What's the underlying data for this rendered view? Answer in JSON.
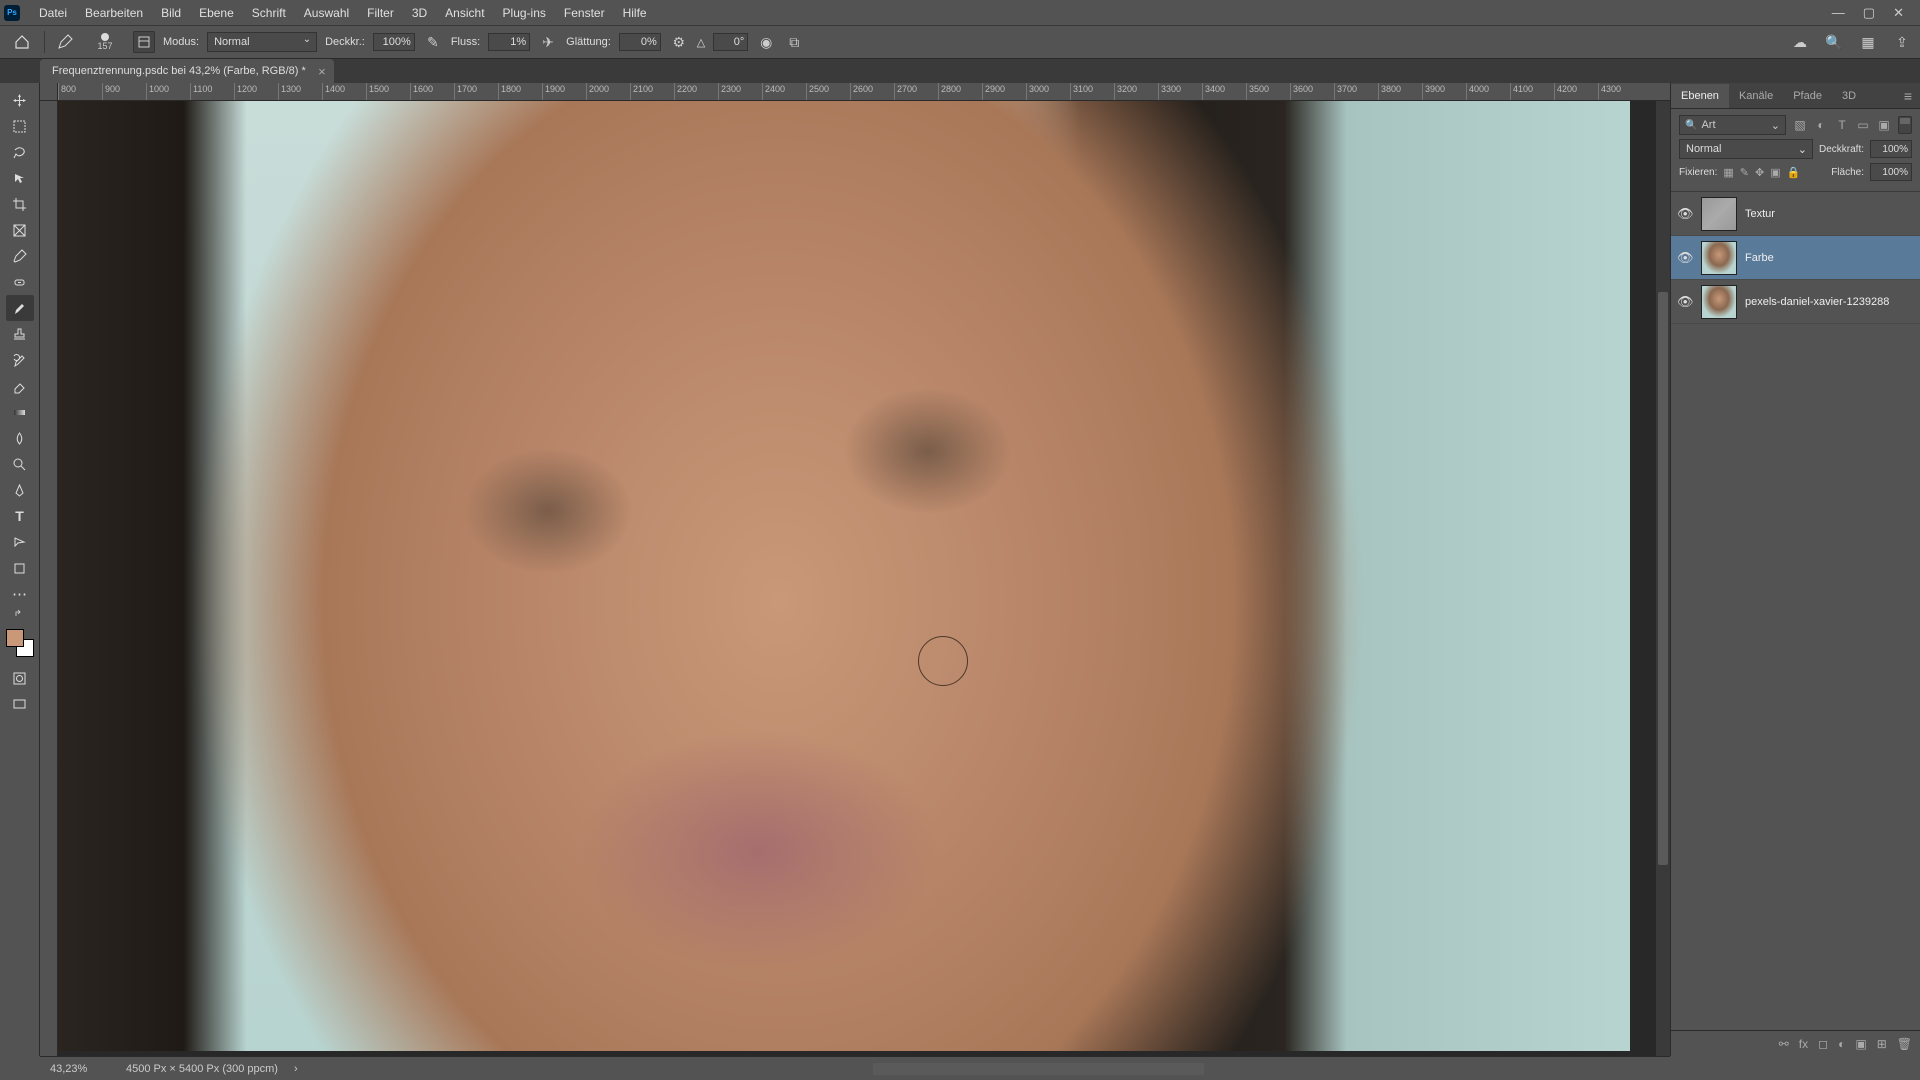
{
  "menu": {
    "items": [
      "Datei",
      "Bearbeiten",
      "Bild",
      "Ebene",
      "Schrift",
      "Auswahl",
      "Filter",
      "3D",
      "Ansicht",
      "Plug-ins",
      "Fenster",
      "Hilfe"
    ]
  },
  "options": {
    "brush_size": "157",
    "mode_label": "Modus:",
    "mode_value": "Normal",
    "opacity_label": "Deckkr.:",
    "opacity_value": "100%",
    "flow_label": "Fluss:",
    "flow_value": "1%",
    "smoothing_label": "Glättung:",
    "smoothing_value": "0%",
    "angle_label": "△",
    "angle_value": "0°"
  },
  "document": {
    "tab_title": "Frequenztrennung.psdc bei 43,2% (Farbe, RGB/8) *"
  },
  "ruler_ticks": [
    "800",
    "900",
    "1000",
    "1100",
    "1200",
    "1300",
    "1400",
    "1500",
    "1600",
    "1700",
    "1800",
    "1900",
    "2000",
    "2100",
    "2200",
    "2300",
    "2400",
    "2500",
    "2600",
    "2700",
    "2800",
    "2900",
    "3000",
    "3100",
    "3200",
    "3300",
    "3400",
    "3500",
    "3600",
    "3700",
    "3800",
    "3900",
    "4000",
    "4100",
    "4200",
    "4300"
  ],
  "panels": {
    "tabs": [
      "Ebenen",
      "Kanäle",
      "Pfade",
      "3D"
    ],
    "search_type": "Art",
    "blend_mode": "Normal",
    "opacity_label": "Deckkraft:",
    "opacity_value": "100%",
    "fill_label": "Fixieren:",
    "fill2_label": "Fläche:",
    "fill_value": "100%",
    "layers": [
      {
        "name": "Textur",
        "selected": false,
        "thumb": "texture"
      },
      {
        "name": "Farbe",
        "selected": true,
        "thumb": "photo"
      },
      {
        "name": "pexels-daniel-xavier-1239288",
        "selected": false,
        "thumb": "photo"
      }
    ]
  },
  "status": {
    "zoom": "43,23%",
    "doc_info": "4500 Px × 5400 Px (300 ppcm)"
  }
}
